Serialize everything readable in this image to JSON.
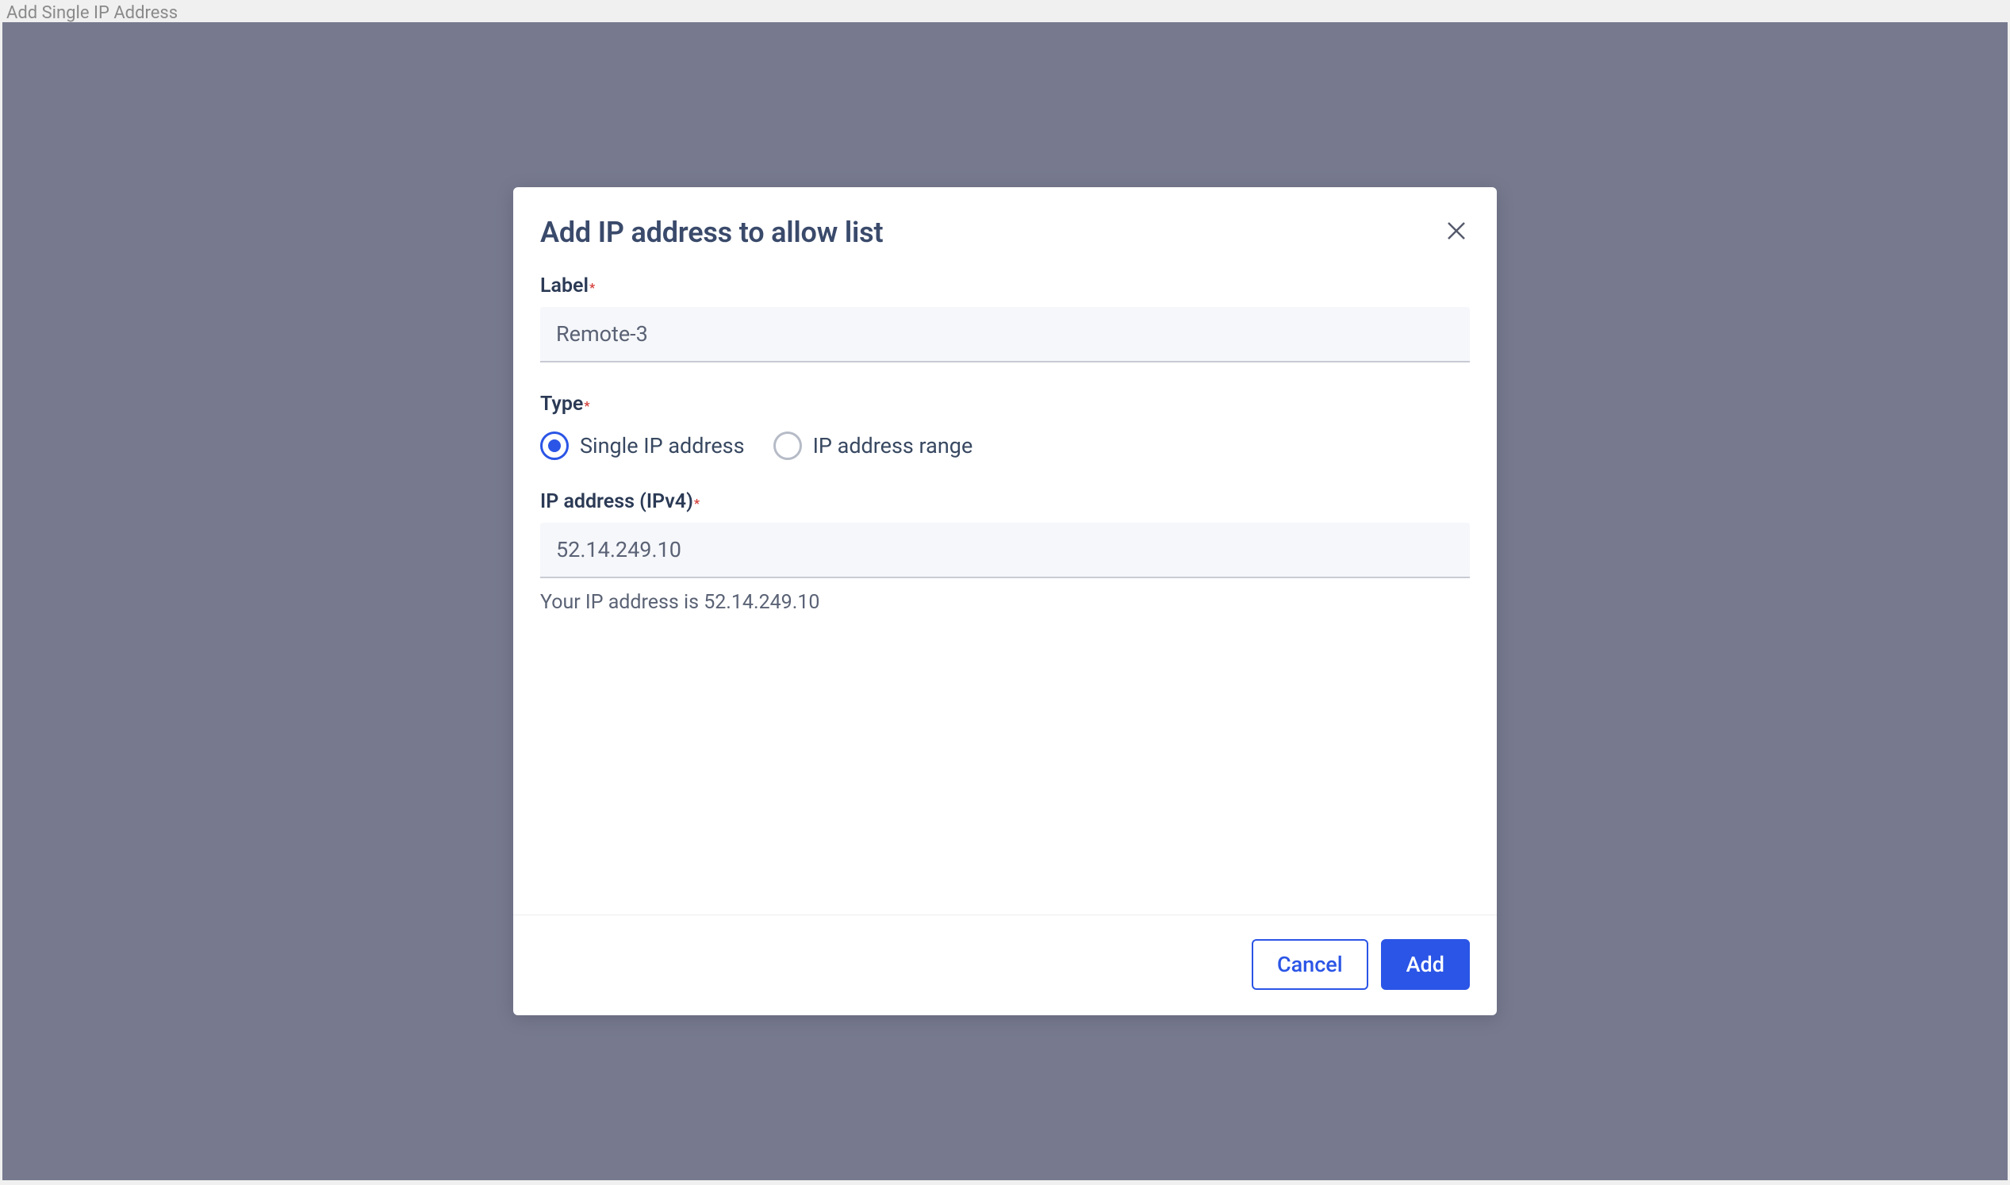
{
  "topBar": {
    "title": "Add Single IP Address"
  },
  "modal": {
    "title": "Add IP address to allow list",
    "fields": {
      "label": {
        "title": "Label",
        "required": "*",
        "value": "Remote-3"
      },
      "type": {
        "title": "Type",
        "required": "*",
        "options": {
          "single": "Single IP address",
          "range": "IP address range"
        }
      },
      "ip": {
        "title": "IP address (IPv4)",
        "required": "*",
        "value": "52.14.249.10",
        "hint": "Your IP address is 52.14.249.10"
      }
    },
    "buttons": {
      "cancel": "Cancel",
      "add": "Add"
    }
  }
}
